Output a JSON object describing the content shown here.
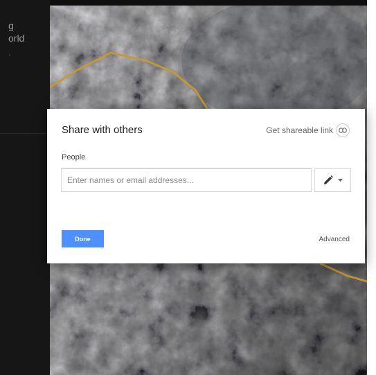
{
  "sidebar": {
    "partial_lines": [
      "g",
      "orld",
      "."
    ]
  },
  "dialog": {
    "title": "Share with others",
    "share_link_label": "Get shareable link",
    "people_label": "People",
    "people_input_placeholder": "Enter names or email addresses...",
    "people_input_value": "",
    "done_label": "Done",
    "advanced_label": "Advanced"
  },
  "icons": {
    "share_link": "link-icon",
    "permission": "pencil-icon",
    "permission_dropdown": "caret-down-icon"
  },
  "colors": {
    "done_button": "#4d90fe",
    "route_line": "#c79a2e",
    "sidebar": "#161617"
  }
}
